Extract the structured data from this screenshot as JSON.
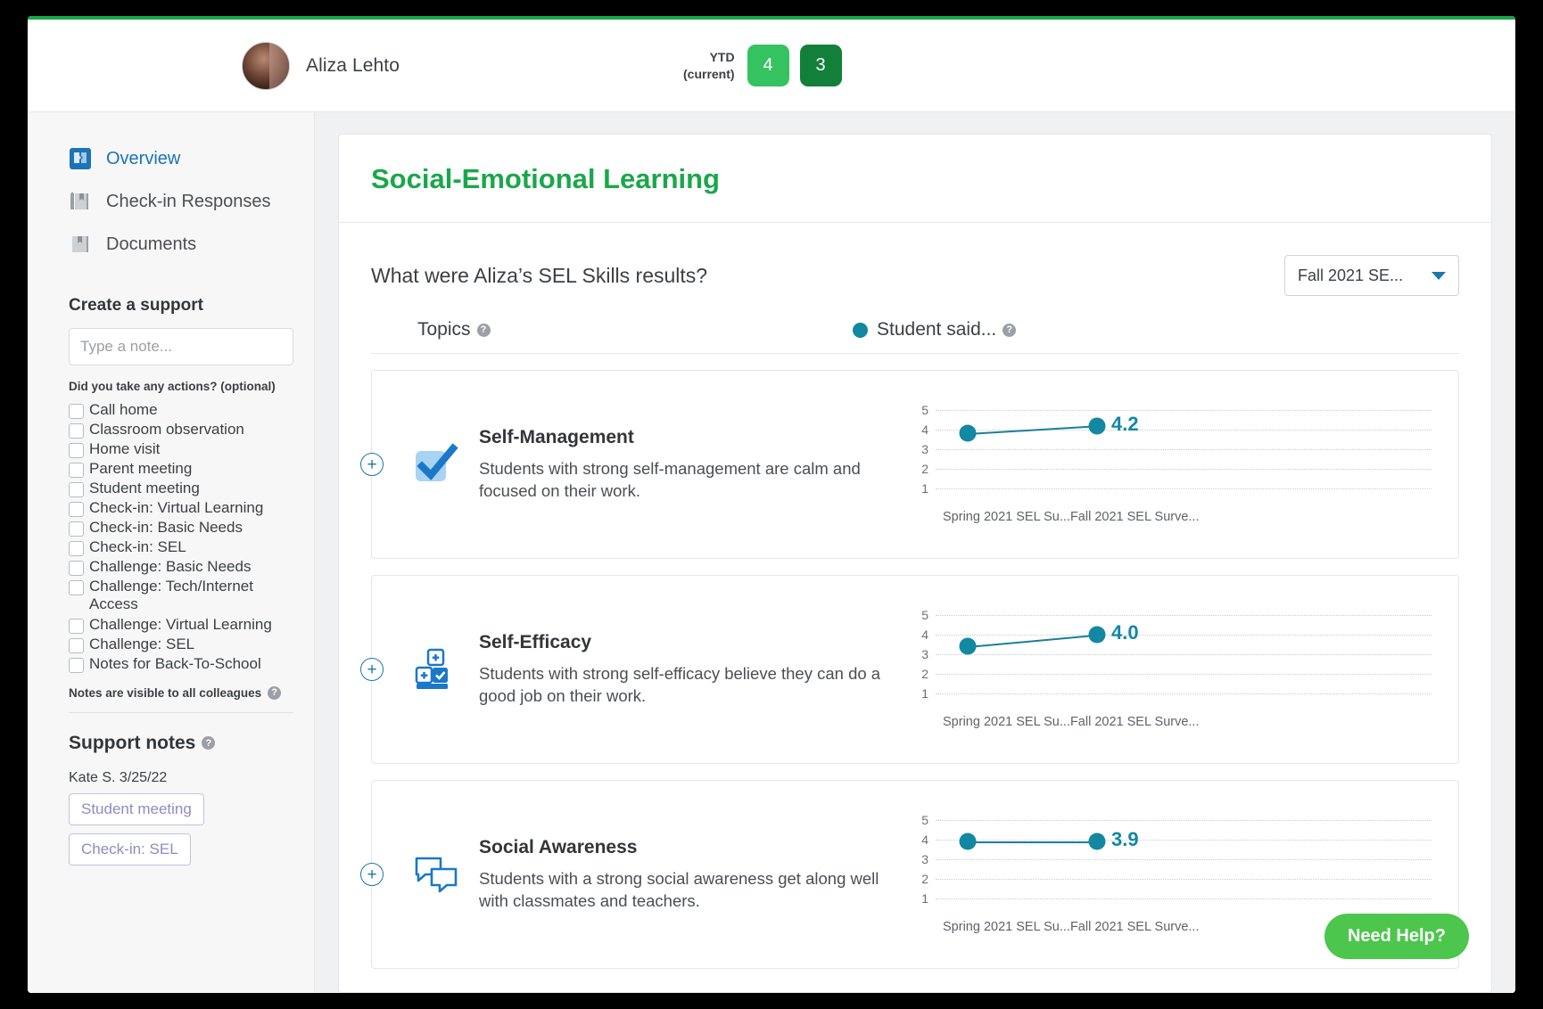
{
  "header": {
    "student_name": "Aliza Lehto",
    "avatar_icon": "student-avatar",
    "ytd_label": "YTD\n(current)",
    "badges": [
      {
        "value": "4",
        "color": "#35c260"
      },
      {
        "value": "3",
        "color": "#128039"
      }
    ]
  },
  "sidebar": {
    "nav": [
      {
        "label": "Overview",
        "icon": "puzzle-icon",
        "active": true
      },
      {
        "label": "Check-in Responses",
        "icon": "book-pencil-icon",
        "active": false
      },
      {
        "label": "Documents",
        "icon": "book-icon",
        "active": false
      }
    ],
    "create_support_title": "Create a support",
    "note_placeholder": "Type a note...",
    "note_value": "",
    "actions_question": "Did you take any actions? (optional)",
    "actions": [
      "Call home",
      "Classroom observation",
      "Home visit",
      "Parent meeting",
      "Student meeting",
      "Check-in: Virtual Learning",
      "Check-in: Basic Needs",
      "Check-in: SEL",
      "Challenge: Basic Needs",
      "Challenge: Tech/Internet Access",
      "Challenge: Virtual Learning",
      "Challenge: SEL",
      "Notes for Back-To-School"
    ],
    "visibility_note": "Notes are visible to all colleagues",
    "support_notes_title": "Support notes",
    "notes": [
      {
        "author_date": "Kate S. 3/25/22",
        "tags": [
          "Student meeting",
          "Check-in: SEL"
        ]
      }
    ]
  },
  "main": {
    "card_title": "Social-Emotional Learning",
    "question": "What were Aliza’s SEL Skills results?",
    "survey_select": {
      "value": "Fall 2021 SE...",
      "caret_icon": "chevron-down-icon",
      "accent": "#1b78a8"
    },
    "columns": {
      "topics": "Topics",
      "student_said": "Student said...",
      "legend_dot_color": "#1288a3"
    },
    "help_button": "Need Help?",
    "help_color": "#4cc64c"
  },
  "chart_data": [
    {
      "type": "line",
      "title": "Self-Management",
      "description": "Students with strong self-management are calm and focused on their work.",
      "icon": "checkmark-icon",
      "categories": [
        "Spring 2021 SEL Su...",
        "Fall 2021 SEL Surve..."
      ],
      "series": [
        {
          "name": "Student said...",
          "values": [
            3.8,
            4.2
          ]
        }
      ],
      "value_label": "4.2",
      "ylim": [
        1,
        5
      ],
      "yticks": [
        "5",
        "4",
        "3",
        "2",
        "1"
      ],
      "grid": true,
      "color": "#1288a3"
    },
    {
      "type": "line",
      "title": "Self-Efficacy",
      "description": "Students with strong self-efficacy believe they can do a good job on their work.",
      "icon": "blocks-icon",
      "categories": [
        "Spring 2021 SEL Su...",
        "Fall 2021 SEL Surve..."
      ],
      "series": [
        {
          "name": "Student said...",
          "values": [
            3.4,
            4.0
          ]
        }
      ],
      "value_label": "4.0",
      "ylim": [
        1,
        5
      ],
      "yticks": [
        "5",
        "4",
        "3",
        "2",
        "1"
      ],
      "grid": true,
      "color": "#1288a3"
    },
    {
      "type": "line",
      "title": "Social Awareness",
      "description": "Students with a strong social awareness get along well with classmates and teachers.",
      "icon": "speech-bubbles-icon",
      "categories": [
        "Spring 2021 SEL Su...",
        "Fall 2021 SEL Surve..."
      ],
      "series": [
        {
          "name": "Student said...",
          "values": [
            3.9,
            3.9
          ]
        }
      ],
      "value_label": "3.9",
      "ylim": [
        1,
        5
      ],
      "yticks": [
        "5",
        "4",
        "3",
        "2",
        "1"
      ],
      "grid": true,
      "color": "#1288a3"
    }
  ]
}
